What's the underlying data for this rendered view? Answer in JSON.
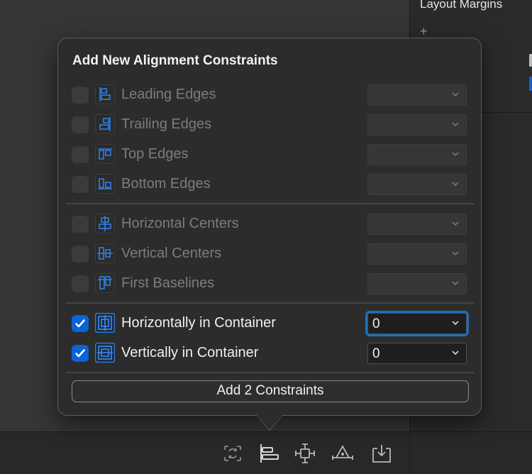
{
  "inspector": {
    "title": "Layout Margins",
    "plus": "+"
  },
  "popover": {
    "title": "Add New Alignment Constraints",
    "rows": [
      {
        "label": "Leading Edges",
        "checked": false,
        "value": "",
        "icon": "align-leading-edges-icon"
      },
      {
        "label": "Trailing Edges",
        "checked": false,
        "value": "",
        "icon": "align-trailing-edges-icon"
      },
      {
        "label": "Top Edges",
        "checked": false,
        "value": "",
        "icon": "align-top-edges-icon"
      },
      {
        "label": "Bottom Edges",
        "checked": false,
        "value": "",
        "icon": "align-bottom-edges-icon"
      },
      {
        "label": "Horizontal Centers",
        "checked": false,
        "value": "",
        "icon": "align-horizontal-centers-icon"
      },
      {
        "label": "Vertical Centers",
        "checked": false,
        "value": "",
        "icon": "align-vertical-centers-icon"
      },
      {
        "label": "First Baselines",
        "checked": false,
        "value": "",
        "icon": "align-first-baselines-icon"
      },
      {
        "label": "Horizontally in Container",
        "checked": true,
        "value": "0",
        "icon": "horizontally-in-container-icon"
      },
      {
        "label": "Vertically in Container",
        "checked": true,
        "value": "0",
        "icon": "vertically-in-container-icon"
      }
    ],
    "add_button": "Add 2 Constraints"
  },
  "toolbar": {
    "icons": [
      "update-frames-icon",
      "align-icon",
      "add-new-constraints-icon",
      "resolve-auto-layout-issues-icon",
      "embed-in-icon"
    ]
  },
  "colors": {
    "accent": "#0a64d8",
    "icon_blue": "#2f7fe6",
    "focus_ring": "#1c6fbf"
  }
}
